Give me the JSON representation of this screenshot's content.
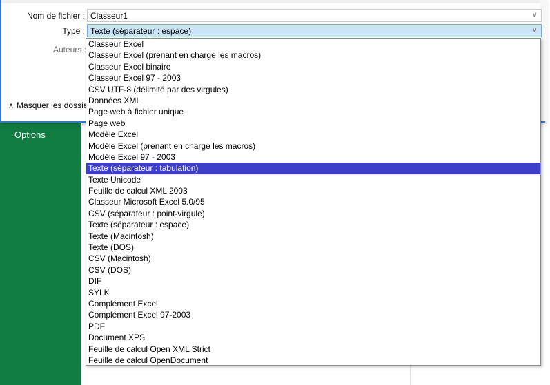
{
  "sidebar": {
    "options_label": "Options",
    "color": "#107c41"
  },
  "dialog": {
    "filename_label": "Nom de fichier :",
    "filename_value": "Classeur1",
    "type_label": "Type :",
    "type_value": "Texte (séparateur : espace)",
    "authors_label": "Auteurs :",
    "hide_folders_label": "Masquer les dossie",
    "accent": "#2b78d8"
  },
  "dropdown": {
    "selected_index": 12,
    "options": [
      "Classeur Excel",
      "Classeur Excel (prenant en charge les macros)",
      "Classeur Excel binaire",
      "Classeur Excel 97 - 2003",
      "CSV UTF-8 (délimité par des virgules)",
      "Données XML",
      "Page web à fichier unique",
      "Page web",
      "Modèle Excel",
      "Modèle Excel (prenant en charge les macros)",
      "Modèle Excel 97 - 2003",
      "Texte (séparateur : tabulation)",
      "Texte Unicode",
      "Feuille de calcul XML 2003",
      "Classeur Microsoft Excel 5.0/95",
      "CSV (séparateur : point-virgule)",
      "Texte (séparateur : espace)",
      "Texte (Macintosh)",
      "Texte (DOS)",
      "CSV (Macintosh)",
      "CSV (DOS)",
      "DIF",
      "SYLK",
      "Complément Excel",
      "Complément Excel 97-2003",
      "PDF",
      "Document XPS",
      "Feuille de calcul Open XML Strict",
      "Feuille de calcul OpenDocument"
    ],
    "highlight_label": "Texte (séparateur : tabulation)",
    "highlight_color": "#3d3ec9"
  }
}
